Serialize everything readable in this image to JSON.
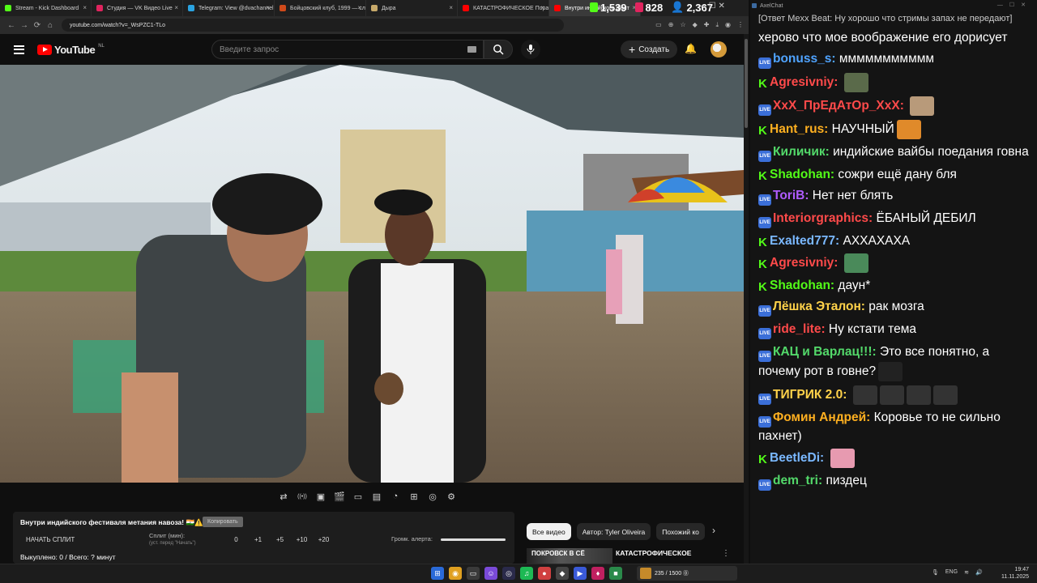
{
  "browser": {
    "tabs": [
      {
        "title": "Stream - Kick Dashboard",
        "color": "#53fc18",
        "active": false
      },
      {
        "title": "Студия — VK Видео Live",
        "color": "#e0245e",
        "active": false
      },
      {
        "title": "Telegram: View @dvachannel",
        "color": "#2aa3e0",
        "active": false
      },
      {
        "title": "Бойцовский клуб, 1999 — сл",
        "color": "#d04a1a",
        "active": false
      },
      {
        "title": "Дыра",
        "color": "#c7a96a",
        "active": false
      },
      {
        "title": "КАТАСТРОФИЧЕСКОЕ Пора",
        "color": "#ff0000",
        "active": false
      },
      {
        "title": "Внутри индийского фест",
        "color": "#ff0000",
        "active": true
      }
    ],
    "url": "youtube.com/watch?v=_WsPZC1-TLo",
    "window_controls": "—   ☐   ✕"
  },
  "counters": {
    "kick": "1,539",
    "vk": "828",
    "total": "2,367",
    "kick_color": "#53fc18",
    "vk_color": "#e0245e",
    "total_color": "#3b8ee8"
  },
  "youtube": {
    "logo_text": "YouTube",
    "logo_region": "NL",
    "search_placeholder": "Введите запрос",
    "create_label": "Создать"
  },
  "toolbar_icons": [
    "loop-icon",
    "broadcast-icon",
    "screen-record-icon",
    "clapper-icon",
    "frame-icon",
    "subtitles-icon",
    "speed-icon",
    "add-icon",
    "camera-icon",
    "settings-icon"
  ],
  "panel": {
    "title": "Внутри индийского фестиваля метания навоза! 🇮🇳⚠️",
    "lang": "IN",
    "subscribe_label": "Копировать",
    "start_split": "НАЧАТЬ СПЛИТ",
    "split_label": "Сплит (мин):",
    "split_sub": "(уст. перед \"Начать\")",
    "split_value": "0",
    "steps": [
      "+1",
      "+5",
      "+10",
      "+20"
    ],
    "alert_volume_label": "Громк. алерта:",
    "alert_volume": 1.0,
    "bought": "Выкуплено: 0 / Всего: ? минут"
  },
  "chips": [
    "Все видео",
    "Автор: Tyler Oliveira",
    "Похожий ко"
  ],
  "recommended": {
    "thumb_text": "ПОКРОВСК В СЁ",
    "title": "КАТАСТРОФИЧЕСКОЕ"
  },
  "chat": {
    "window_title": "AxelChat",
    "messages": [
      {
        "platform": "none",
        "nick": "",
        "nick_color": "#ffffff",
        "text": "[Ответ Mexx Beat: Ну хорошо что стримы запах не передают]",
        "small": true
      },
      {
        "platform": "none",
        "nick": "",
        "nick_color": "#ffffff",
        "text": "херово что мое воображение его дорисует"
      },
      {
        "platform": "live",
        "nick": "bonuss_s:",
        "nick_color": "#4fa3ff",
        "text": "ммммммммммм"
      },
      {
        "platform": "kick",
        "nick": "Agresivniy:",
        "nick_color": "#ff4a4a",
        "text": "",
        "emote": "#5a6a4a"
      },
      {
        "platform": "live",
        "nick": "XxX_ПрЕдАтОр_XxX:",
        "nick_color": "#ff4a4a",
        "text": "",
        "emote": "#b89a7a"
      },
      {
        "platform": "kick",
        "nick": "Hant_rus:",
        "nick_color": "#ffb020",
        "text": "НАУЧНЫЙ",
        "emote": "#e08a2a"
      },
      {
        "platform": "live",
        "nick": "Киличик:",
        "nick_color": "#53d96a",
        "text": "индийские вайбы поедания говна"
      },
      {
        "platform": "kick",
        "nick": "Shadohan:",
        "nick_color": "#53fc18",
        "text": "сожри ещё дану бля"
      },
      {
        "platform": "live",
        "nick": "ToriB:",
        "nick_color": "#b05cff",
        "text": "Нет нет блять"
      },
      {
        "platform": "live",
        "nick": "Interiorgraphics:",
        "nick_color": "#ff4a4a",
        "text": "ЁБАНЫЙ ДЕБИЛ"
      },
      {
        "platform": "kick",
        "nick": "Exalted777:",
        "nick_color": "#7ab8ff",
        "text": "АХХАХАХА"
      },
      {
        "platform": "kick",
        "nick": "Agresivniy:",
        "nick_color": "#ff4a4a",
        "text": "",
        "emote": "#4a8a5a"
      },
      {
        "platform": "kick",
        "nick": "Shadohan:",
        "nick_color": "#53fc18",
        "text": "даун*"
      },
      {
        "platform": "live",
        "nick": "Лёшка Эталон:",
        "nick_color": "#ffd24a",
        "text": "рак мозга"
      },
      {
        "platform": "live",
        "nick": "ride_lite:",
        "nick_color": "#ff4a4a",
        "text": "Ну кстати тема"
      },
      {
        "platform": "live",
        "nick": "КАЦ и Варлац!!!:",
        "nick_color": "#53d96a",
        "text": "Это все понятно, а почему рот в говне?",
        "emote": "#222222"
      },
      {
        "platform": "live",
        "nick": "ТИГРИК 2.0:",
        "nick_color": "#ffd24a",
        "text": "",
        "emote_count": 4,
        "emote": "#333333"
      },
      {
        "platform": "live",
        "nick": "Фомин Андрей:",
        "nick_color": "#ffb020",
        "text": "Коровье то не сильно пахнет)"
      },
      {
        "platform": "kick",
        "nick": "BeetleDi:",
        "nick_color": "#7ab8ff",
        "text": "",
        "emote": "#e79ab0"
      },
      {
        "platform": "live",
        "nick": "dem_tri:",
        "nick_color": "#53d96a",
        "text": "пиздец"
      }
    ]
  },
  "taskbar": {
    "media_text": "235 / 1500 ⓪",
    "tray_lang": "ENG",
    "time": "19:47",
    "date": "11.11.2025"
  }
}
